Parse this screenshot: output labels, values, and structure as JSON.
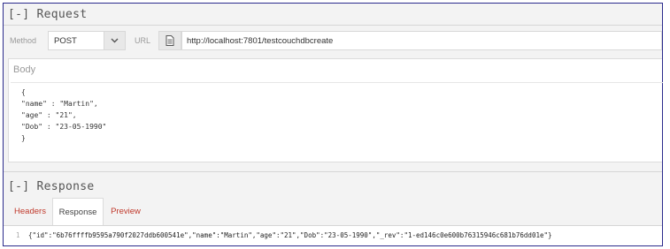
{
  "request": {
    "section_title": "[-] Request",
    "method_label": "Method",
    "method_value": "POST",
    "url_label": "URL",
    "url_value": "http://localhost:7801/testcouchdbcreate"
  },
  "body": {
    "label": "Body",
    "lines": [
      "{",
      "\"name\" : \"Martin\",",
      "\"age\" : \"21\",",
      "\"Dob\" : \"23-05-1990\"",
      "}"
    ]
  },
  "response": {
    "section_title": "[-] Response",
    "tabs": [
      "Headers",
      "Response",
      "Preview"
    ],
    "active_tab": "Response",
    "line_number": "1",
    "content": "{\"id\":\"6b76ffffb9595a790f2027ddb600541e\",\"name\":\"Martin\",\"age\":\"21\",\"Dob\":\"23-05-1990\",\"_rev\":\"1-ed146c0e600b76315946c681b76dd01e\"}"
  },
  "icons": {
    "method_dropdown": "chevron-down-icon",
    "url_icon": "document-icon"
  },
  "colors": {
    "tab_link": "#c0392b",
    "frame_border": "#2b2b8c"
  }
}
